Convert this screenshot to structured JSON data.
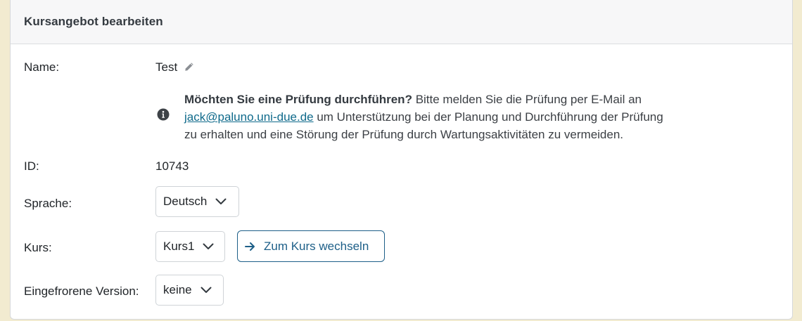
{
  "card": {
    "title": "Kursangebot bearbeiten"
  },
  "fields": {
    "name_label": "Name:",
    "name_value": "Test",
    "id_label": "ID:",
    "id_value": "10743",
    "language_label": "Sprache:",
    "language_value": "Deutsch",
    "course_label": "Kurs:",
    "course_value": "Kurs1",
    "frozen_label": "Eingefrorene Version:",
    "frozen_value": "keine"
  },
  "info": {
    "bold": "Möchten Sie eine Prüfung durchführen?",
    "text1": " Bitte melden Sie die Prüfung per E-Mail an",
    "email": "jack@paluno.uni-due.de",
    "text2": " um Unterstützung bei der Planung und Durchführung der Prüfung",
    "text3": "zu erhalten und eine Störung der Prüfung durch Wartungsaktivitäten zu vermeiden."
  },
  "buttons": {
    "switch_course": "Zum Kurs wechseln"
  },
  "icons": {
    "edit": "pencil-icon",
    "info": "info-circle-icon",
    "dropdown": "chevron-down-icon",
    "switch": "arrow-right-icon"
  },
  "colors": {
    "page_background": "#f2ebd0",
    "link": "#0f6a8b",
    "button_accent": "#1d5f88"
  }
}
